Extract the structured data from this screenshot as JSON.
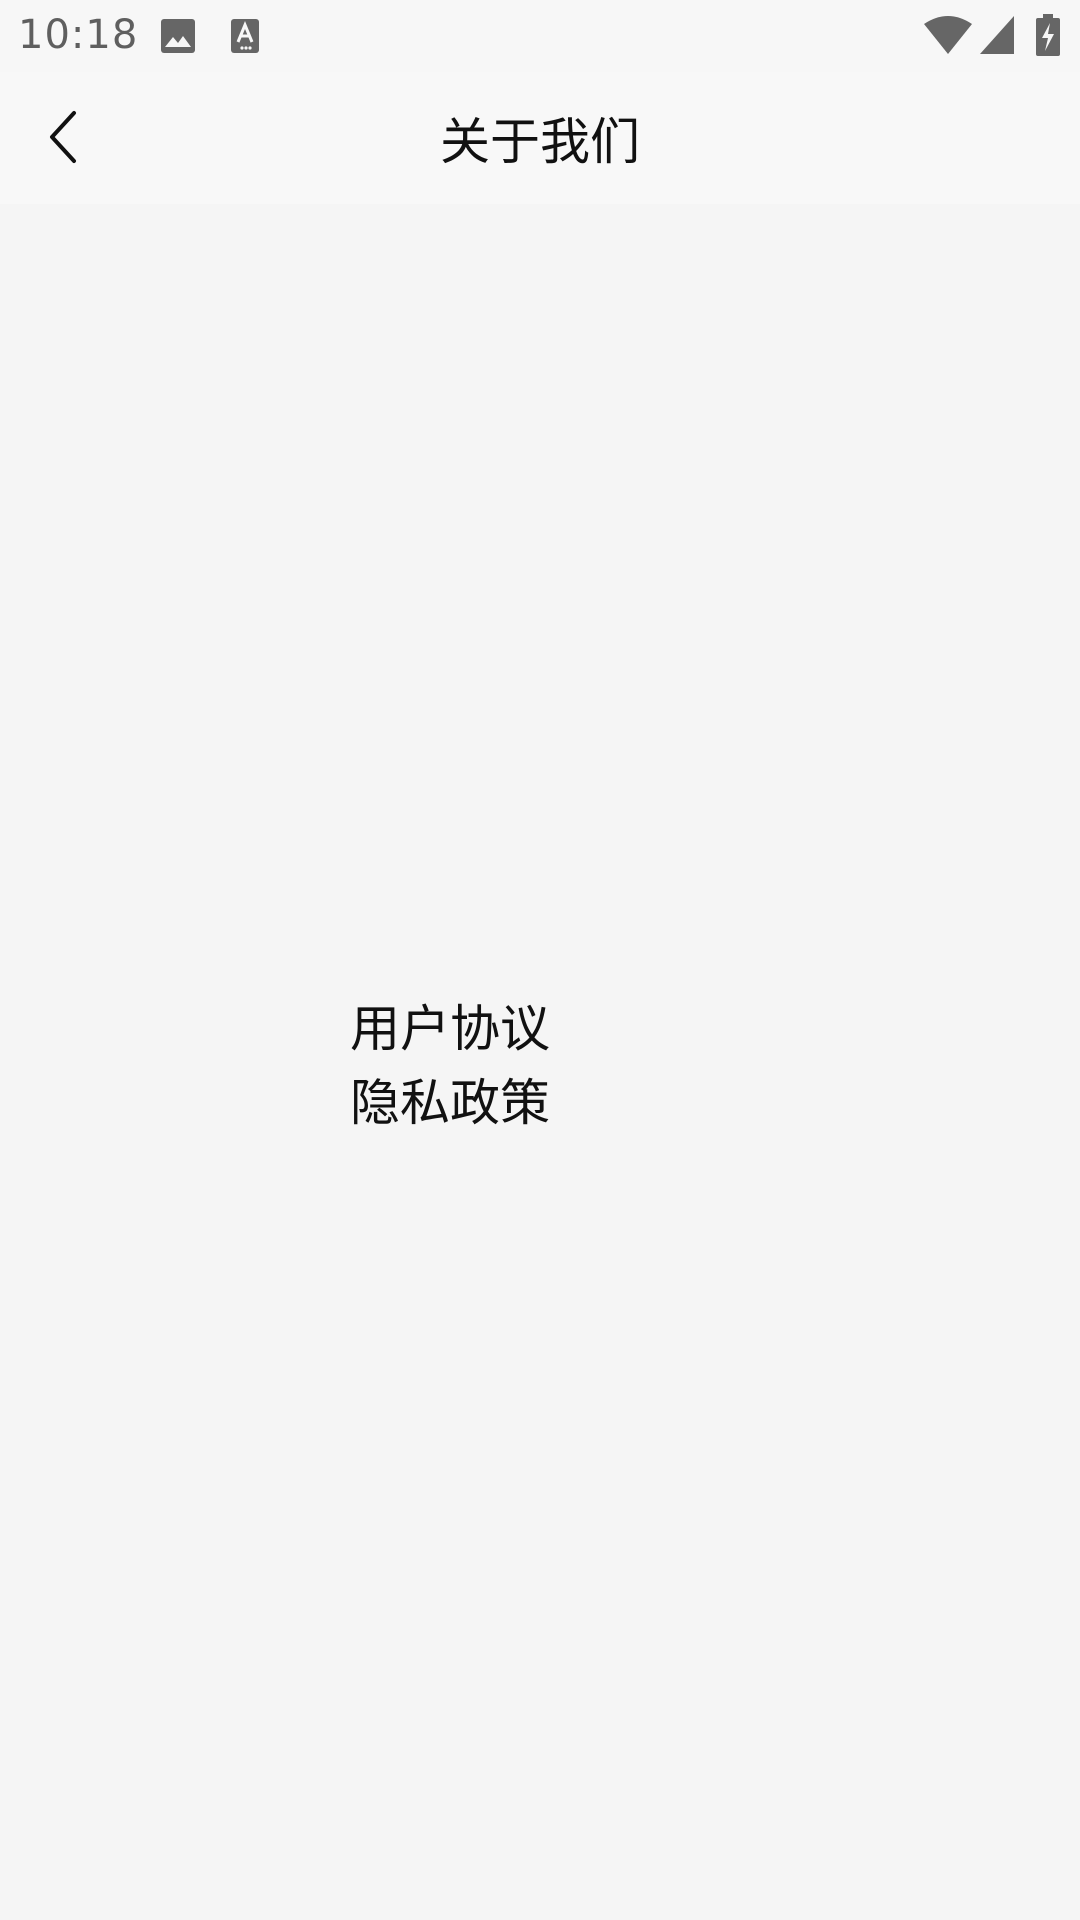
{
  "status_bar": {
    "time": "10:18",
    "icons": [
      "image-notification-icon",
      "text-notification-icon",
      "wifi-icon",
      "cell-signal-icon",
      "battery-charging-icon"
    ],
    "icon_color": "#666666"
  },
  "toolbar": {
    "back_icon": "chevron-left-icon",
    "title": "关于我们"
  },
  "content": {
    "links": [
      {
        "label": "用户协议"
      },
      {
        "label": "隐私政策"
      }
    ]
  },
  "colors": {
    "background": "#f5f5f5",
    "toolbar_background": "#f8f8f8",
    "text": "#111111",
    "status_text": "#5f5f5f"
  }
}
